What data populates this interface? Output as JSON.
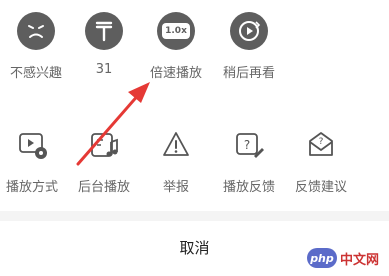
{
  "sheet": {
    "row1": [
      {
        "label": "不感兴趣",
        "icon": "dislike-face-icon"
      },
      {
        "label": "31",
        "icon": "tenge-currency-icon"
      },
      {
        "label": "倍速播放",
        "icon": "speed-1x-icon",
        "badge": "1.0x"
      },
      {
        "label": "稍后再看",
        "icon": "watch-later-icon"
      }
    ],
    "row2": [
      {
        "label": "播放方式",
        "icon": "play-mode-icon"
      },
      {
        "label": "后台播放",
        "icon": "background-play-icon"
      },
      {
        "label": "举报",
        "icon": "report-warning-icon"
      },
      {
        "label": "播放反馈",
        "icon": "feedback-edit-icon"
      },
      {
        "label": "反馈建议",
        "icon": "suggestion-mail-icon"
      }
    ],
    "cancel_label": "取消"
  },
  "annotation": {
    "color": "#e53935",
    "type": "red-arrow"
  },
  "watermark": {
    "badge": "php",
    "text": "中文网"
  }
}
